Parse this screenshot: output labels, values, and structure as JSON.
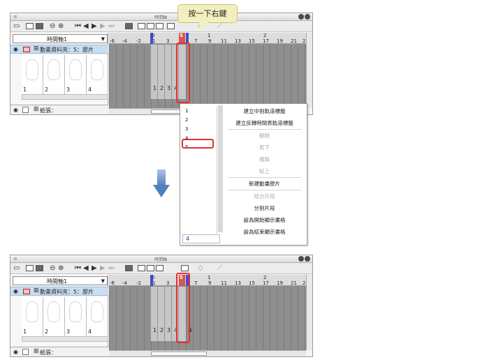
{
  "tooltip": {
    "text": "按一下右鍵"
  },
  "panel_top": {
    "window_title": "時間軸",
    "timeline_dropdown": "時間軸1",
    "folder_label": "動畫資料夾：5：膠片",
    "paper_label": "紙張：",
    "current_frame": "5",
    "ruler_big": [
      "0",
      "1",
      "2"
    ],
    "ruler_ticks": [
      "-6",
      "-4",
      "-2",
      "1",
      "3",
      "7",
      "9",
      "11",
      "13",
      "15",
      "17",
      "19",
      "21",
      "23"
    ],
    "thumb_numbers": [
      "1",
      "2",
      "3",
      "4"
    ],
    "frame_numbers": [
      "1",
      "2",
      "3",
      "4"
    ]
  },
  "context_menu": {
    "list_items": [
      "1",
      "2",
      "3",
      "4",
      "5"
    ],
    "input_value": "4",
    "items": [
      {
        "label": "建立中割軌道標籤",
        "enabled": true
      },
      {
        "label": "建立反轉時間表軌道標籤",
        "enabled": true
      },
      {
        "label": "刪除",
        "enabled": false
      },
      {
        "label": "剪下",
        "enabled": false
      },
      {
        "label": "複製",
        "enabled": false
      },
      {
        "label": "貼上",
        "enabled": false
      },
      {
        "label": "新建動畫膠片",
        "enabled": true
      },
      {
        "label": "結合片段",
        "enabled": false
      },
      {
        "label": "分割片段",
        "enabled": true
      },
      {
        "label": "設為開始顯示畫格",
        "enabled": true
      },
      {
        "label": "設為結束顯示畫格",
        "enabled": true
      }
    ]
  },
  "panel_bottom": {
    "window_title": "時間軸",
    "timeline_dropdown": "時間軸1",
    "folder_label": "動畫資料夾：5：膠片",
    "paper_label": "紙張：",
    "current_frame": "5",
    "ruler_big": [
      "0",
      "1",
      "2"
    ],
    "ruler_ticks": [
      "-6",
      "-4",
      "-2",
      "1",
      "3",
      "7",
      "9",
      "11",
      "13",
      "15",
      "17",
      "19",
      "21",
      "23"
    ],
    "thumb_numbers": [
      "1",
      "2",
      "3",
      "4"
    ],
    "frame_numbers": [
      "1",
      "2",
      "3",
      "4",
      "5"
    ]
  },
  "colors": {
    "highlight": "#e53030",
    "folder_bg": "#c9def1",
    "arrow": "#4f7fbf",
    "tooltip_bg": "#f2efbf"
  }
}
